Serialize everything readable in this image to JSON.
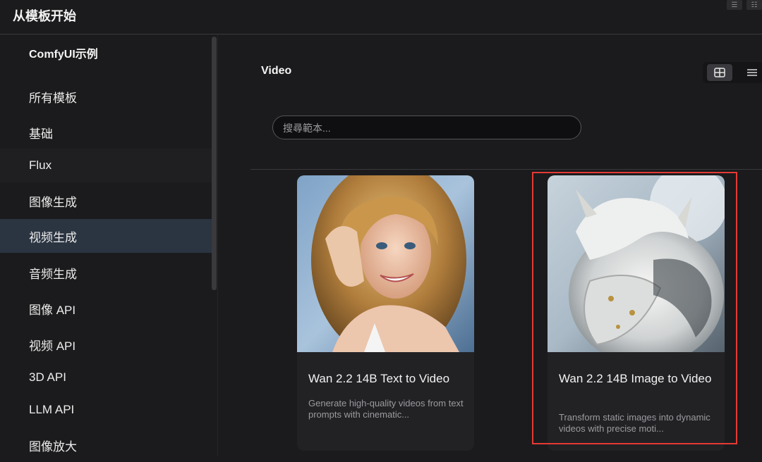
{
  "window": {
    "title": "从模板开始"
  },
  "sidebar": {
    "section_title": "ComfyUI示例",
    "items": [
      {
        "label": "所有模板"
      },
      {
        "label": "基础"
      },
      {
        "label": "Flux"
      },
      {
        "label": "图像生成"
      },
      {
        "label": "视频生成"
      },
      {
        "label": "音频生成"
      },
      {
        "label": "图像 API"
      },
      {
        "label": "视频 API"
      },
      {
        "label": "3D API"
      },
      {
        "label": "LLM API"
      },
      {
        "label": "图像放大"
      }
    ],
    "active_item": "视频生成"
  },
  "main": {
    "title": "Video",
    "search": {
      "placeholder": "搜尋範本...",
      "value": ""
    },
    "view_modes": [
      "grid-icon",
      "list-icon"
    ],
    "selected_view": "grid",
    "cards": [
      {
        "title": "Wan 2.2 14B Text to Video",
        "description": "Generate high-quality videos from text prompts with cinematic...",
        "thumbnail": "portrait-photo-woman"
      },
      {
        "title": "Wan 2.2 14B Image to Video",
        "description": "Transform static images into dynamic videos with precise moti...",
        "thumbnail": "white-armored-dragon",
        "highlighted": true
      }
    ]
  },
  "colors": {
    "accent_active": "#2b3441",
    "highlight": "#e53935",
    "background": "#1b1b1d"
  }
}
